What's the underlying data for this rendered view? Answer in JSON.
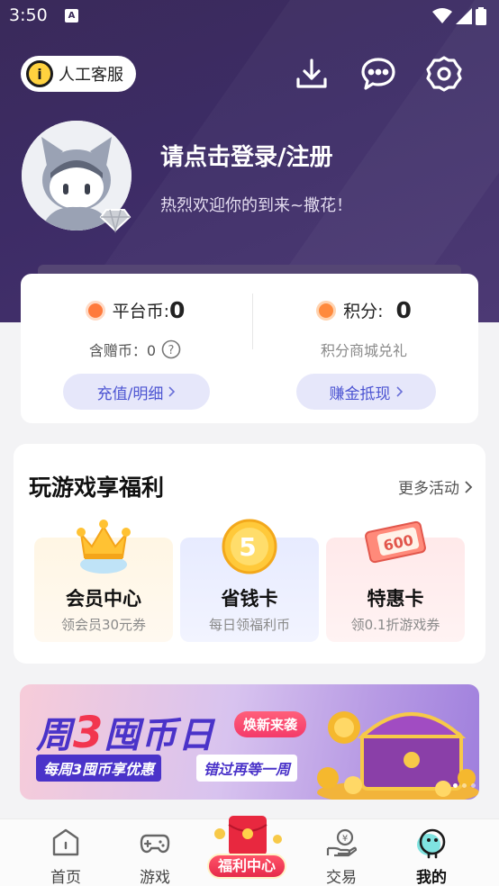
{
  "status_bar": {
    "time": "3:50",
    "notification_icon": "A"
  },
  "header": {
    "customer_service_label": "人工客服",
    "login_title": "请点击登录/注册",
    "login_subtitle": "热烈欢迎你的到来~撒花！"
  },
  "wallet": {
    "platform_coin_label": "平台币:",
    "platform_coin_value": "0",
    "gift_coin_label": "含赠币：0",
    "points_label": "积分:",
    "points_value": "0",
    "points_sub": "积分商城兑礼",
    "recharge_button": "充值/明细",
    "earn_button": "赚金抵现"
  },
  "benefits": {
    "title": "玩游戏享福利",
    "more_label": "更多活动",
    "items": [
      {
        "title": "会员中心",
        "sub": "领会员30元券",
        "icon": "crown-icon"
      },
      {
        "title": "省钱卡",
        "sub": "每日领福利币",
        "icon": "coin-5-icon",
        "badge": "5"
      },
      {
        "title": "特惠卡",
        "sub": "领0.1折游戏券",
        "icon": "ticket-600-icon",
        "badge": "600"
      }
    ]
  },
  "banner": {
    "title_prefix": "周",
    "title_num": "3",
    "title_suffix": "囤币日",
    "tag": "焕新来袭",
    "sub1": "每周3囤币享优惠",
    "sub2": "错过再等一周"
  },
  "bottom_nav": {
    "items": [
      {
        "label": "首页",
        "icon": "home-icon"
      },
      {
        "label": "游戏",
        "icon": "gamepad-icon"
      },
      {
        "label": "福利中心",
        "icon": "red-envelope-icon"
      },
      {
        "label": "交易",
        "icon": "trade-icon"
      },
      {
        "label": "我的",
        "icon": "mine-icon"
      }
    ]
  },
  "colors": {
    "header_purple": "#3d2c66",
    "accent_blue": "#4c54d2",
    "banner_blue": "#4a33c9",
    "welfare_red": "#e62b4b"
  }
}
